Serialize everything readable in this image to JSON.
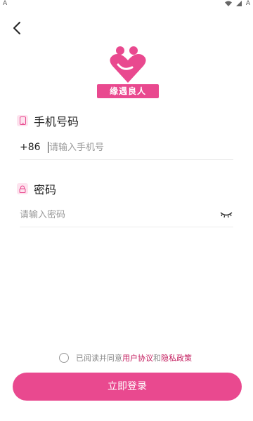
{
  "status_bar": {
    "left_glyph": "A",
    "right_glyph": "A"
  },
  "logo": {
    "text": "缘遇良人"
  },
  "phone": {
    "label": "手机号码",
    "country_code": "+86",
    "placeholder": "请输入手机号",
    "value": ""
  },
  "password": {
    "label": "密码",
    "placeholder": "请输入密码",
    "value": ""
  },
  "agreement": {
    "prefix": "已阅读并同意",
    "user_agreement": "用户协议",
    "and": "和",
    "privacy_policy": "隐私政策",
    "checked": false
  },
  "login_button": {
    "label": "立即登录"
  },
  "colors": {
    "accent": "#e9498f",
    "link": "#c2185b",
    "icon_bg": "#fde3ee"
  },
  "icons": [
    "back-arrow",
    "phone-icon",
    "lock-icon",
    "eye-closed-icon",
    "logo-heart"
  ]
}
